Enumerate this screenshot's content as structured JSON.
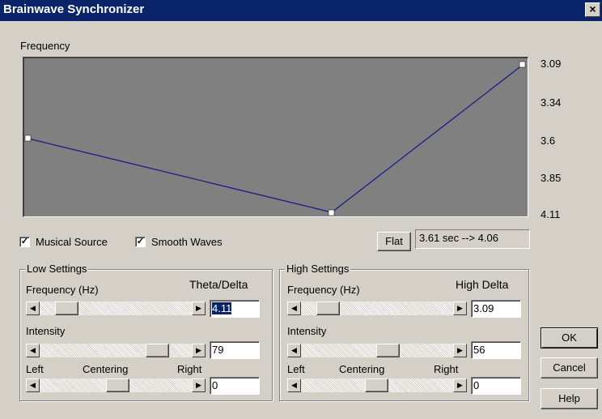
{
  "window": {
    "title": "Brainwave Synchronizer",
    "close_label": "×"
  },
  "graph": {
    "label": "Frequency",
    "ticks": [
      "3.09",
      "3.34",
      "3.6",
      "3.85",
      "4.11"
    ],
    "line_color": "#1c1c8c",
    "background_color": "#808080"
  },
  "options": {
    "musical_source": {
      "label": "Musical Source",
      "checked": true
    },
    "smooth_waves": {
      "label": "Smooth Waves",
      "checked": true
    }
  },
  "flat_button": "Flat",
  "readout": "3.61 sec --> 4.06",
  "low": {
    "title": "Low Settings",
    "frequency_label": "Frequency (Hz)",
    "band_label": "Theta/Delta",
    "frequency_value": "4.11",
    "intensity_label": "Intensity",
    "intensity_value": "79",
    "left_label": "Left",
    "centering_label": "Centering",
    "right_label": "Right",
    "centering_value": "0"
  },
  "high": {
    "title": "High Settings",
    "frequency_label": "Frequency (Hz)",
    "band_label": "High Delta",
    "frequency_value": "3.09",
    "intensity_label": "Intensity",
    "intensity_value": "56",
    "left_label": "Left",
    "centering_label": "Centering",
    "right_label": "Right",
    "centering_value": "0"
  },
  "buttons": {
    "ok": "OK",
    "cancel": "Cancel",
    "help": "Help"
  }
}
